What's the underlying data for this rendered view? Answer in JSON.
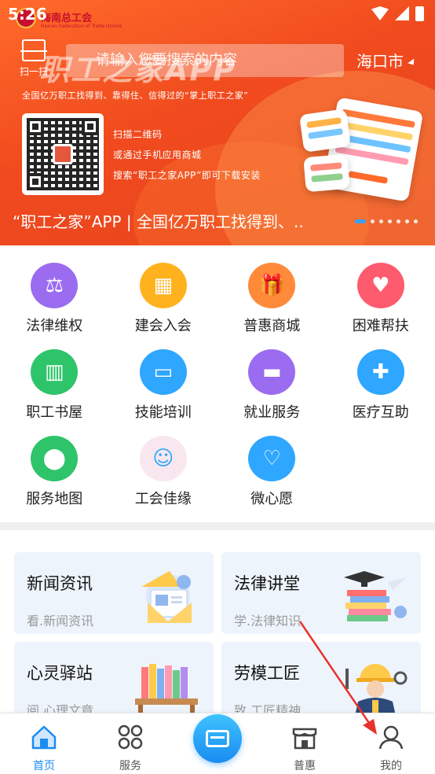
{
  "status_bar": {
    "time": "5:26"
  },
  "org": {
    "name": "海南总工会",
    "name_en": "Hainan Federation of Trade Unions"
  },
  "header": {
    "scan_label": "扫一扫",
    "search_placeholder": "请输入您要搜索的内容",
    "city": "海口市"
  },
  "banner": {
    "title": "职工之家APP",
    "slogan": "全国亿万职工找得到、靠得住、信得过的“掌上职工之家”",
    "instructions": [
      "扫描二维码",
      "或通过手机应用商城",
      "搜索“职工之家APP”即可下载安装"
    ],
    "caption": "“职工之家”APP | 全国亿万职工找得到、..",
    "dot_count": 7,
    "active_dot": 0
  },
  "services": [
    {
      "label": "法律维权",
      "icon": "scales-icon",
      "color": "#9b6cf0"
    },
    {
      "label": "建会入会",
      "icon": "building-icon",
      "color": "#ffb21e"
    },
    {
      "label": "普惠商城",
      "icon": "gift-icon",
      "color": "#ff8a3a"
    },
    {
      "label": "困难帮扶",
      "icon": "heart-hands-icon",
      "color": "#ff5b6e"
    },
    {
      "label": "职工书屋",
      "icon": "books-icon",
      "color": "#2ec46a"
    },
    {
      "label": "技能培训",
      "icon": "easel-icon",
      "color": "#2fa6ff"
    },
    {
      "label": "就业服务",
      "icon": "briefcase-icon",
      "color": "#9b6cf0"
    },
    {
      "label": "医疗互助",
      "icon": "medkit-icon",
      "color": "#2fa6ff"
    },
    {
      "label": "服务地图",
      "icon": "map-pin-icon",
      "color": "#2ec46a"
    },
    {
      "label": "工会佳缘",
      "icon": "mascot-icon",
      "color": "#f8e7ef"
    },
    {
      "label": "微心愿",
      "icon": "chat-heart-icon",
      "color": "#2fa6ff"
    }
  ],
  "cards": {
    "news": {
      "title": "新闻资讯",
      "sub": "看.新闻资讯"
    },
    "law": {
      "title": "法律讲堂",
      "sub": "学.法律知识"
    },
    "mind": {
      "title": "心灵驿站",
      "sub": "阅.心理文章"
    },
    "model": {
      "title": "劳模工匠",
      "sub": "致.工匠精神"
    }
  },
  "bottom_nav": {
    "home": "首页",
    "service": "服务",
    "puhui": "普惠",
    "mine": "我的",
    "active_color": "#1a8cf0"
  }
}
